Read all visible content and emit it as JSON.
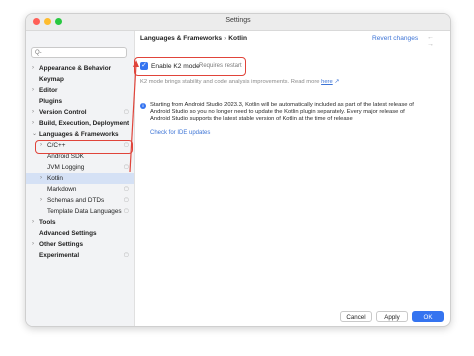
{
  "window": {
    "title": "Settings"
  },
  "search": {
    "placeholder": "Q-"
  },
  "sidebar": {
    "items": [
      {
        "label": "Appearance & Behavior",
        "bold": true,
        "chevron": "›",
        "gear": false
      },
      {
        "label": "Keymap",
        "bold": true,
        "chevron": "",
        "gear": false
      },
      {
        "label": "Editor",
        "bold": true,
        "chevron": "›",
        "gear": false
      },
      {
        "label": "Plugins",
        "bold": true,
        "chevron": "",
        "gear": false
      },
      {
        "label": "Version Control",
        "bold": true,
        "chevron": "›",
        "gear": true
      },
      {
        "label": "Build, Execution, Deployment",
        "bold": true,
        "chevron": "›",
        "gear": false
      },
      {
        "label": "Languages & Frameworks",
        "bold": true,
        "chevron": "⌄",
        "gear": false
      },
      {
        "label": "C/C++",
        "bold": false,
        "chevron": "›",
        "gear": true,
        "indent": 1
      },
      {
        "label": "Android SDK",
        "bold": false,
        "chevron": "",
        "gear": false,
        "indent": 1
      },
      {
        "label": "JVM Logging",
        "bold": false,
        "chevron": "",
        "gear": true,
        "indent": 1
      },
      {
        "label": "Kotlin",
        "bold": false,
        "chevron": "›",
        "gear": false,
        "indent": 1,
        "selected": true
      },
      {
        "label": "Markdown",
        "bold": false,
        "chevron": "",
        "gear": true,
        "indent": 1
      },
      {
        "label": "Schemas and DTDs",
        "bold": false,
        "chevron": "›",
        "gear": true,
        "indent": 1
      },
      {
        "label": "Template Data Languages",
        "bold": false,
        "chevron": "",
        "gear": true,
        "indent": 1
      },
      {
        "label": "Tools",
        "bold": true,
        "chevron": "›",
        "gear": false
      },
      {
        "label": "Advanced Settings",
        "bold": true,
        "chevron": "",
        "gear": false
      },
      {
        "label": "Other Settings",
        "bold": true,
        "chevron": "›",
        "gear": false
      },
      {
        "label": "Experimental",
        "bold": true,
        "chevron": "",
        "gear": true
      }
    ]
  },
  "main": {
    "breadcrumb": [
      "Languages & Frameworks",
      "Kotlin"
    ],
    "breadcrumb_sep": "›",
    "revert": "Revert changes",
    "nav_arrows": "← →",
    "k2": {
      "label": "Enable K2 mode",
      "hint": "Requires restart",
      "description": "K2 mode brings stability and code analysis improvements. Read more ",
      "link": "here",
      "link_suffix": " ↗"
    },
    "info": "Starting from Android Studio 2023.3, Kotlin will be automatically included as part of the latest release of Android Studio so you no longer need to update the Kotlin plugin separately. Every major release of Android Studio supports the latest stable version of Kotlin at the time of release",
    "check_updates": "Check for IDE updates"
  },
  "footer": {
    "cancel": "Cancel",
    "apply": "Apply",
    "ok": "OK"
  },
  "colors": {
    "accent": "#3574f0",
    "highlight": "#e0443a",
    "link": "#3d74d6"
  }
}
